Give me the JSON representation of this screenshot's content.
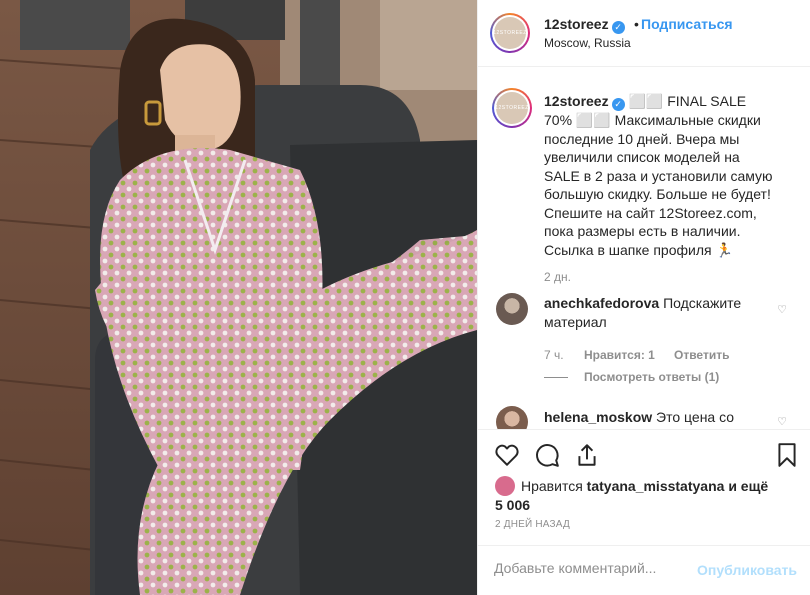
{
  "header": {
    "username": "12storeez",
    "separator": "•",
    "follow_label": "Подписаться",
    "location": "Moscow, Russia",
    "avatar_text": "12STOREEZ"
  },
  "caption": {
    "username": "12storeez",
    "text": "⬜⬜ FINAL SALE 70% ⬜⬜ Максимальные скидки последние 10 дней. Вчера мы увеличили список моделей на SALE в 2 раза и установили самую большую скидку. Больше не будет! Спешите на сайт 12Storeez.com, пока размеры есть в наличии. Ссылка в шапке профиля 🏃",
    "time": "2 дн."
  },
  "comments": [
    {
      "username": "anechkafedorova",
      "text": "Подскажите материал",
      "time": "7 ч.",
      "likes_label": "Нравится: 1",
      "reply_label": "Ответить",
      "view_replies": "Посмотреть ответы (1)"
    },
    {
      "username": "helena_moskow",
      "text": "Это цена со"
    }
  ],
  "actions": {
    "icons": [
      "heart-icon",
      "comment-icon",
      "share-icon",
      "bookmark-icon"
    ]
  },
  "likes": {
    "prefix": "Нравится",
    "user": "tatyana_misstatyana",
    "suffix": "и ещё 5 006"
  },
  "post_date": "2 ДНЕЙ НАЗАД",
  "add_comment": {
    "placeholder": "Добавьте комментарий...",
    "publish_label": "Опубликовать"
  },
  "colors": {
    "accent": "#3897f0",
    "muted": "#8e8e8e",
    "publish_disabled": "#b2dffc",
    "border": "#efefef"
  }
}
